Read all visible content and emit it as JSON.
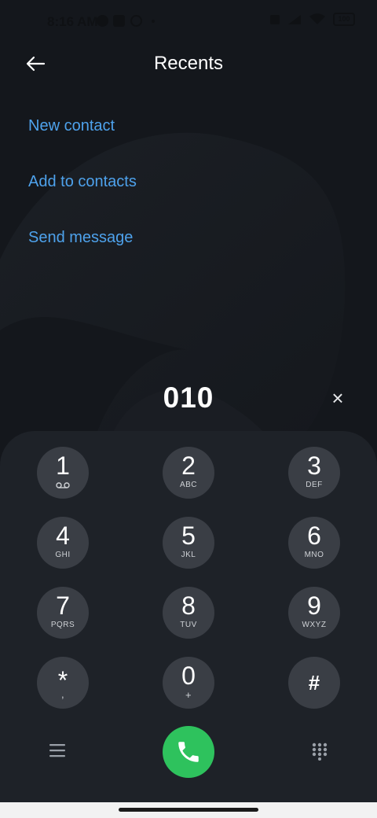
{
  "status_bar": {
    "time": "8:16 AM",
    "battery": "100"
  },
  "header": {
    "title": "Recents",
    "back_icon": "arrow-left-icon"
  },
  "actions": [
    {
      "label": "New contact"
    },
    {
      "label": "Add to contacts"
    },
    {
      "label": "Send message"
    }
  ],
  "dialer": {
    "number": "010",
    "clear_label": "×"
  },
  "keypad": [
    {
      "digit": "1",
      "letters": "",
      "icon": "voicemail-icon"
    },
    {
      "digit": "2",
      "letters": "ABC"
    },
    {
      "digit": "3",
      "letters": "DEF"
    },
    {
      "digit": "4",
      "letters": "GHI"
    },
    {
      "digit": "5",
      "letters": "JKL"
    },
    {
      "digit": "6",
      "letters": "MNO"
    },
    {
      "digit": "7",
      "letters": "PQRS"
    },
    {
      "digit": "8",
      "letters": "TUV"
    },
    {
      "digit": "9",
      "letters": "WXYZ"
    },
    {
      "digit": "*",
      "letters": ","
    },
    {
      "digit": "0",
      "letters": "+"
    },
    {
      "digit": "#",
      "letters": ""
    }
  ],
  "colors": {
    "accent_link": "#4ea2ec",
    "call_green": "#2ec25d",
    "key_bg": "#3a3e45"
  }
}
